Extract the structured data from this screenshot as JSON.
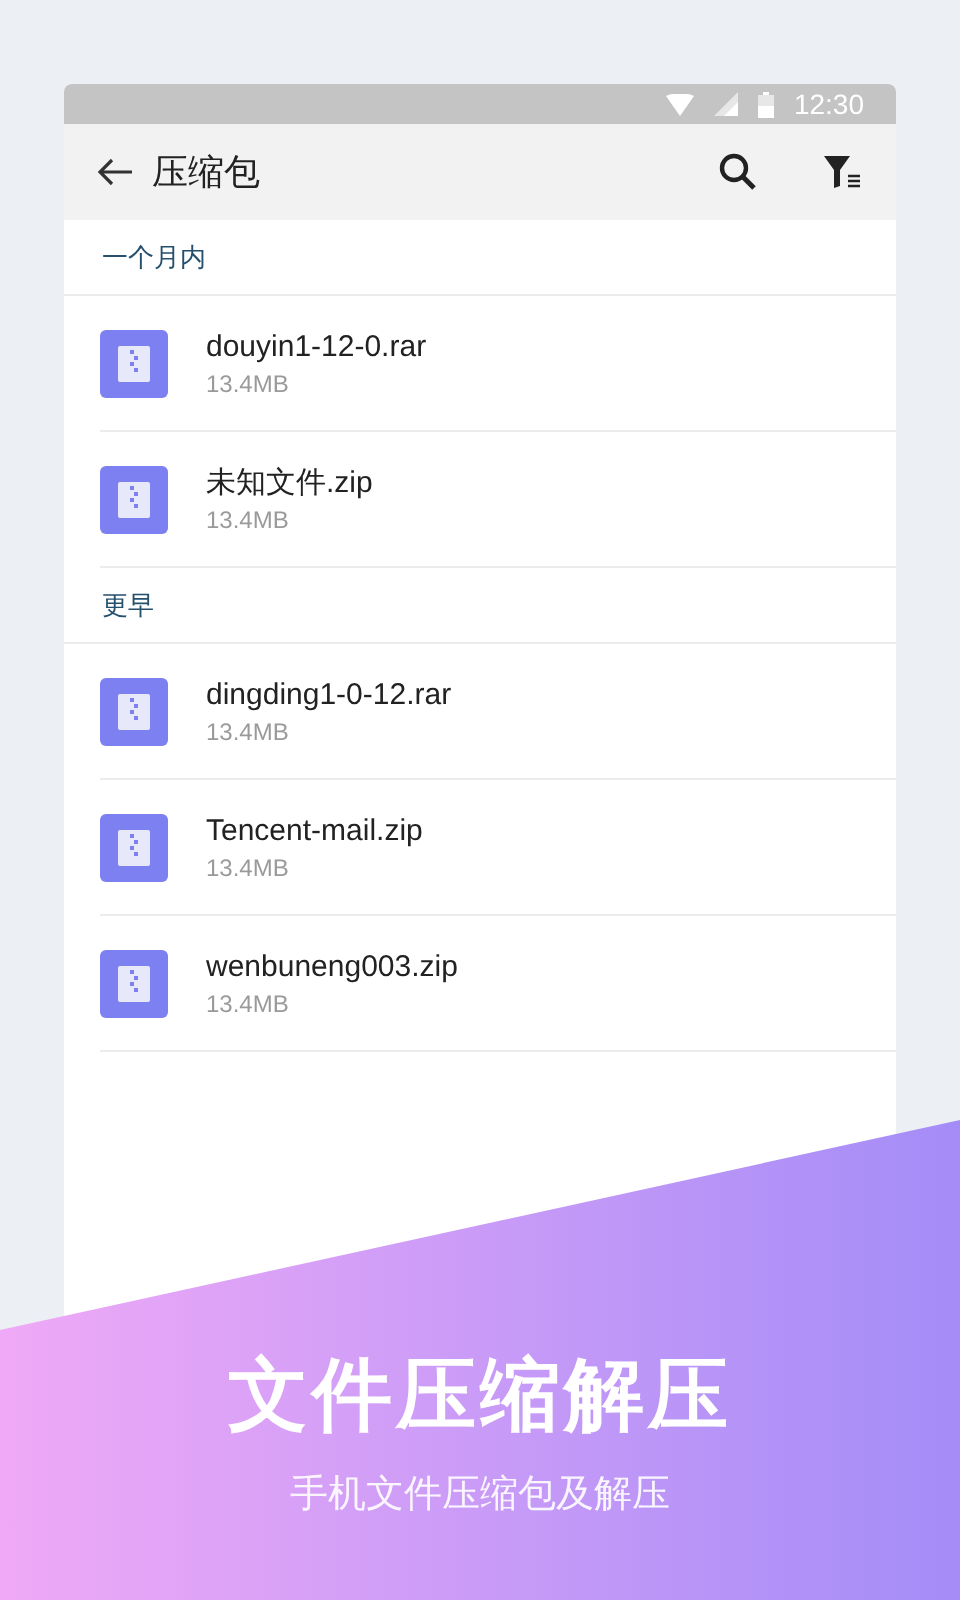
{
  "status_bar": {
    "time": "12:30"
  },
  "app_bar": {
    "title": "压缩包"
  },
  "sections": [
    {
      "header": "一个月内",
      "files": [
        {
          "name": "douyin1-12-0.rar",
          "size": "13.4MB"
        },
        {
          "name": "未知文件.zip",
          "size": "13.4MB"
        }
      ]
    },
    {
      "header": "更早",
      "files": [
        {
          "name": "dingding1-0-12.rar",
          "size": "13.4MB"
        },
        {
          "name": "Tencent-mail.zip",
          "size": "13.4MB"
        },
        {
          "name": "wenbuneng003.zip",
          "size": "13.4MB"
        }
      ]
    }
  ],
  "banner": {
    "title": "文件压缩解压",
    "subtitle": "手机文件压缩包及解压"
  }
}
